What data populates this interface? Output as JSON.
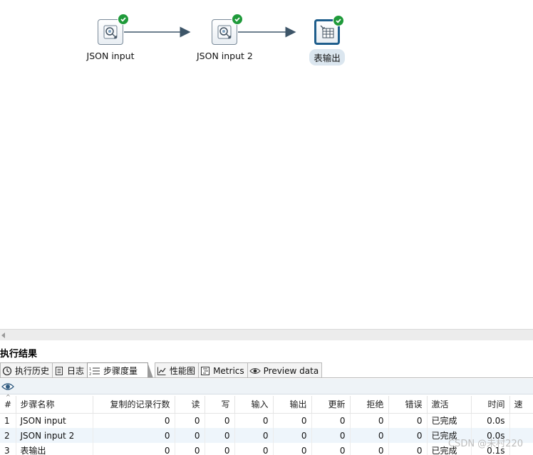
{
  "canvas": {
    "steps": [
      {
        "label": "JSON input",
        "icon": "json-input-icon",
        "status": "ok"
      },
      {
        "label": "JSON input 2",
        "icon": "json-input-icon",
        "status": "ok"
      },
      {
        "label": "表输出",
        "icon": "table-output-icon",
        "status": "ok"
      }
    ]
  },
  "results": {
    "title": "执行结果",
    "tabs": [
      {
        "label": "执行历史",
        "icon": "history-icon"
      },
      {
        "label": "日志",
        "icon": "log-icon"
      },
      {
        "label": "步骤度量",
        "icon": "step-metrics-icon",
        "active": true
      },
      {
        "label": "性能图",
        "icon": "performance-chart-icon"
      },
      {
        "label": "Metrics",
        "icon": "metrics-icon"
      },
      {
        "label": "Preview data",
        "icon": "preview-eye-icon"
      }
    ],
    "columns": [
      "#",
      "步骤名称",
      "复制的记录行数",
      "读",
      "写",
      "输入",
      "输出",
      "更新",
      "拒绝",
      "错误",
      "激活",
      "时间",
      "速"
    ],
    "rows": [
      [
        "1",
        "JSON input",
        "0",
        "0",
        "0",
        "0",
        "0",
        "0",
        "0",
        "0",
        "已完成",
        "0.0s"
      ],
      [
        "2",
        "JSON input 2",
        "0",
        "0",
        "0",
        "0",
        "0",
        "0",
        "0",
        "0",
        "已完成",
        "0.0s"
      ],
      [
        "3",
        "表输出",
        "0",
        "0",
        "0",
        "0",
        "0",
        "0",
        "0",
        "0",
        "已完成",
        "0.1s"
      ]
    ]
  },
  "watermark": "CSDN @未村220",
  "colors": {
    "ok": "#1f9a3a",
    "hop": "#3d5568",
    "selected_border": "#1f5e8c"
  }
}
